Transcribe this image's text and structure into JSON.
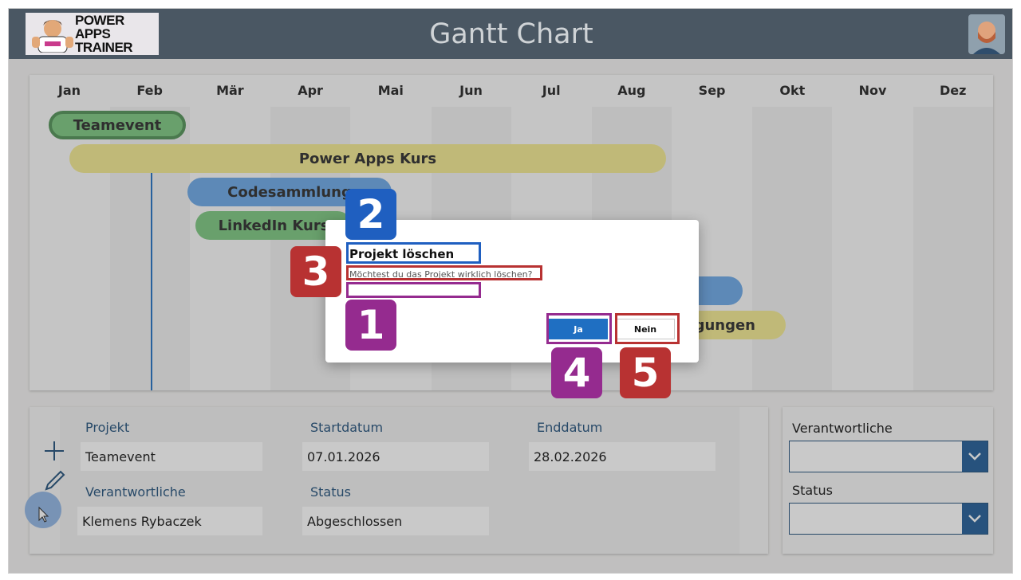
{
  "header": {
    "logo_line1": "POWER APPS",
    "logo_line2": "TRAINER",
    "title": "Gantt Chart"
  },
  "months": [
    "Jan",
    "Feb",
    "Mär",
    "Apr",
    "Mai",
    "Jun",
    "Jul",
    "Aug",
    "Sep",
    "Okt",
    "Nov",
    "Dez"
  ],
  "projects": [
    {
      "label": "Teamevent",
      "color": "#7bc67e",
      "border": "#4f9155"
    },
    {
      "label": "Power Apps Kurs",
      "color": "#f3e98f"
    },
    {
      "label": "Codesammlung",
      "color": "#6aa7e6"
    },
    {
      "label": "LinkedIn Kurs",
      "color": "#7bc67e"
    },
    {
      "label": "",
      "color": "#6aa7e6"
    },
    {
      "label": "tigungen",
      "color": "#f3e98f"
    }
  ],
  "form": {
    "projekt_label": "Projekt",
    "projekt_value": "Teamevent",
    "start_label": "Startdatum",
    "start_value": "07.01.2026",
    "end_label": "Enddatum",
    "end_value": "28.02.2026",
    "owner_label": "Verantwortliche",
    "owner_value": "Klemens Rybaczek",
    "status_label": "Status",
    "status_value": "Abgeschlossen"
  },
  "filters": {
    "owner_label": "Verantwortliche",
    "status_label": "Status"
  },
  "dialog": {
    "title": "Projekt löschen",
    "message": "Möchtest du das Projekt wirklich löschen?",
    "yes_label": "Ja",
    "no_label": "Nein"
  },
  "annotations": [
    "1",
    "2",
    "3",
    "4",
    "5"
  ],
  "colors": {
    "purple": "#952b8f",
    "blue": "#1f5fc0",
    "red": "#b83232"
  }
}
